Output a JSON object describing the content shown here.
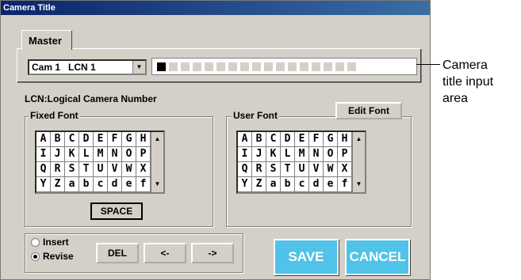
{
  "window": {
    "title": "Camera Title"
  },
  "tabs": [
    {
      "label": "Master"
    }
  ],
  "camera_select": {
    "value": "Cam 1   LCN 1"
  },
  "title_input": {
    "cells": 17
  },
  "callout": {
    "line1": "Camera",
    "line2": "title input",
    "line3": "area"
  },
  "note": "LCN:Logical Camera Number",
  "fixed_font": {
    "legend": "Fixed Font",
    "rows": [
      [
        "A",
        "B",
        "C",
        "D",
        "E",
        "F",
        "G",
        "H"
      ],
      [
        "I",
        "J",
        "K",
        "L",
        "M",
        "N",
        "O",
        "P"
      ],
      [
        "Q",
        "R",
        "S",
        "T",
        "U",
        "V",
        "W",
        "X"
      ],
      [
        "Y",
        "Z",
        "a",
        "b",
        "c",
        "d",
        "e",
        "f"
      ]
    ],
    "space_label": "SPACE"
  },
  "user_font": {
    "legend": "User Font",
    "edit_label": "Edit Font",
    "rows": [
      [
        "A",
        "B",
        "C",
        "D",
        "E",
        "F",
        "G",
        "H"
      ],
      [
        "I",
        "J",
        "K",
        "L",
        "M",
        "N",
        "O",
        "P"
      ],
      [
        "Q",
        "R",
        "S",
        "T",
        "U",
        "V",
        "W",
        "X"
      ],
      [
        "Y",
        "Z",
        "a",
        "b",
        "c",
        "d",
        "e",
        "f"
      ]
    ]
  },
  "mode": {
    "insert_label": "Insert",
    "revise_label": "Revise",
    "selected": "Revise"
  },
  "buttons": {
    "del": "DEL",
    "left": "<-",
    "right": "->",
    "save": "SAVE",
    "cancel": "CANCEL"
  },
  "colors": {
    "accent": "#4fc3e9",
    "titlebar": "#0a246a",
    "face": "#d4d0c8"
  }
}
